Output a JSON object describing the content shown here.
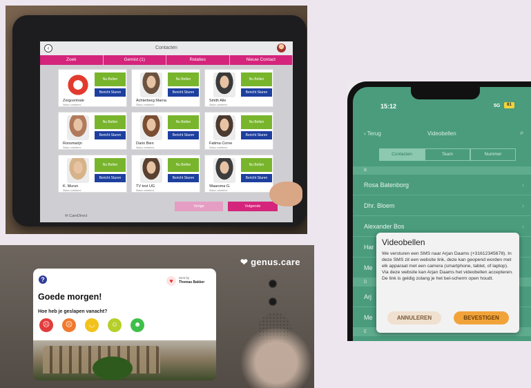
{
  "tablet": {
    "app_title": "Contacten",
    "tabs": [
      {
        "label": "Zoek"
      },
      {
        "label": "Gemist (1)"
      },
      {
        "label": "Relaties"
      },
      {
        "label": "Nieuw Contact"
      }
    ],
    "contacts": [
      {
        "name": "Zorgcentrale",
        "status": "Status onbekend",
        "call_label": "Nu Bellen",
        "msg_label": "Bericht Sturen",
        "photo_color": "#ffffff"
      },
      {
        "name": "Achterberg Marna",
        "status": "Status onbekend",
        "call_label": "Nu Bellen",
        "msg_label": "Bericht Sturen",
        "photo_color": "#6b5340"
      },
      {
        "name": "Smith Alle",
        "status": "Status onbekend",
        "call_label": "Nu Bellen",
        "msg_label": "Bericht Sturen",
        "photo_color": "#3b3a3a"
      },
      {
        "name": "Roosmarijn",
        "status": "Status onbekend",
        "call_label": "Nu Bellen",
        "msg_label": "Bericht Sturen",
        "photo_color": "#b27a5c"
      },
      {
        "name": "Dario Bien",
        "status": "Status onbekend",
        "call_label": "Nu Bellen",
        "msg_label": "Bericht Sturen",
        "photo_color": "#7a4e32"
      },
      {
        "name": "Fatima Corne",
        "status": "Status onbekend",
        "call_label": "Nu Bellen",
        "msg_label": "Bericht Sturen",
        "photo_color": "#4a3a30"
      },
      {
        "name": "K. Murun",
        "status": "Status onbekend",
        "call_label": "Nu Bellen",
        "msg_label": "Bericht Sturen",
        "photo_color": "#d7b38a"
      },
      {
        "name": "TV test UG",
        "status": "Status onbekend",
        "call_label": "Nu Bellen",
        "msg_label": "Bericht Sturen",
        "photo_color": "#5a4030"
      },
      {
        "name": "Waarsma G.",
        "status": "Status onbekend",
        "call_label": "Nu Bellen",
        "msg_label": "Bericht Sturen",
        "photo_color": "#3d3d3d"
      }
    ],
    "prev_label": "Vorige",
    "next_label": "Volgende",
    "logo_text": "CareDirect",
    "accent_color": "#d4247c",
    "call_color": "#78b52c",
    "msg_color": "#1d3f9e"
  },
  "genus": {
    "brand": "genus.care",
    "sent_by_label": "Sent by",
    "sender_name": "Thomas Bakker",
    "greeting": "Goede morgen!",
    "question": "Hoe heb je geslapen vanacht?",
    "moods": [
      {
        "icon": "very-sad-face-icon",
        "color": "#e23b3b"
      },
      {
        "icon": "sad-face-icon",
        "color": "#f07a2e"
      },
      {
        "icon": "neutral-face-icon",
        "color": "#f2c21b"
      },
      {
        "icon": "smile-face-icon",
        "color": "#b6cf2a"
      },
      {
        "icon": "happy-face-icon",
        "color": "#3fbf4a"
      }
    ]
  },
  "phone": {
    "time": "15:12",
    "network": "5G",
    "battery": "61",
    "back_label": "Terug",
    "title": "Videobellen",
    "segments": [
      {
        "label": "Contacten",
        "active": true
      },
      {
        "label": "Team",
        "active": false
      },
      {
        "label": "Nummer",
        "active": false
      }
    ],
    "section_b": "B",
    "rows": [
      {
        "name": "Rosa Batenborg"
      },
      {
        "name": "Dhr. Bloem"
      },
      {
        "name": "Alexander Bos"
      },
      {
        "name": "Har"
      },
      {
        "name": "Me"
      }
    ],
    "section_d": "D",
    "rows_after": [
      {
        "name": "Arj"
      },
      {
        "name": "Me"
      }
    ],
    "section_e": "E",
    "dialog": {
      "title": "Videobellen",
      "body": "We versturen een SMS naar Arjan Daams (+31612345678). In deze SMS zit een website link, deze kan geopend worden met elk apparaat met een camera (smartphone, tablet, of laptop). Via deze website kan Arjan Daams het videobellen accepteren. De link is geldig zolang je het bel-scherm open houdt.",
      "cancel_label": "ANNULEREN",
      "confirm_label": "BEVESTIGEN"
    },
    "theme_color": "#4a9c7d",
    "confirm_color": "#f1a33a"
  }
}
